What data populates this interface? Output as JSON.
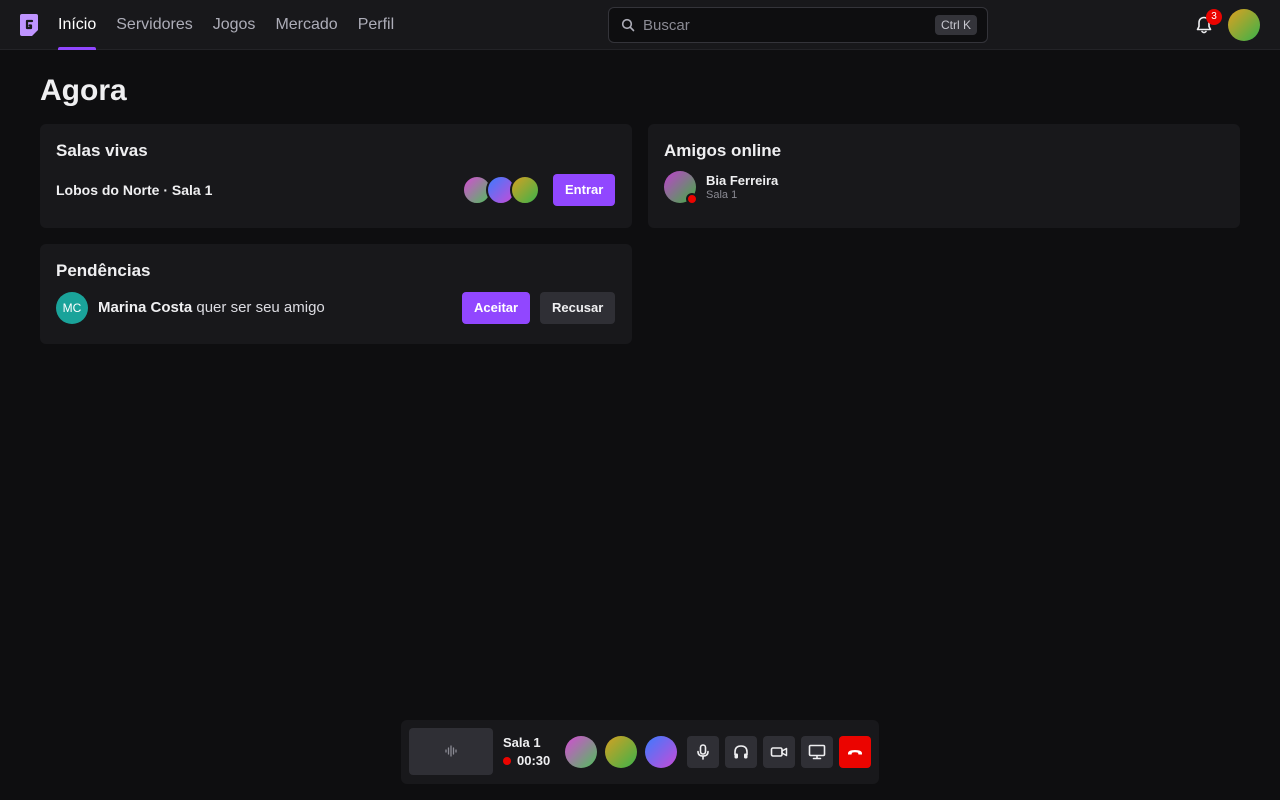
{
  "nav": {
    "items": [
      {
        "label": "Início",
        "active": true
      },
      {
        "label": "Servidores"
      },
      {
        "label": "Jogos"
      },
      {
        "label": "Mercado"
      },
      {
        "label": "Perfil"
      }
    ]
  },
  "search": {
    "placeholder": "Buscar",
    "shortcut": "Ctrl K"
  },
  "notifications": {
    "count": "3"
  },
  "page": {
    "title": "Agora"
  },
  "live_rooms": {
    "title": "Salas vivas",
    "room": "Lobos do Norte · Sala 1",
    "join_label": "Entrar"
  },
  "friends_online": {
    "title": "Amigos online",
    "friends": [
      {
        "name": "Bia Ferreira",
        "location": "Sala 1",
        "status_color": "#eb0400"
      }
    ]
  },
  "pending": {
    "title": "Pendências",
    "requests": [
      {
        "initials": "MC",
        "name": "Marina Costa",
        "message": "quer ser seu amigo"
      }
    ],
    "accept_label": "Aceitar",
    "decline_label": "Recusar"
  },
  "call": {
    "room": "Sala 1",
    "elapsed": "00:30"
  },
  "colors": {
    "accent": "#9147ff",
    "danger": "#eb0400",
    "background": "#0e0e10",
    "card": "#18181b"
  },
  "icons": [
    "logo-icon",
    "search-icon",
    "bell-icon",
    "waveform-icon",
    "microphone-icon",
    "headphones-icon",
    "camera-icon",
    "screen-share-icon",
    "hang-up-icon"
  ]
}
